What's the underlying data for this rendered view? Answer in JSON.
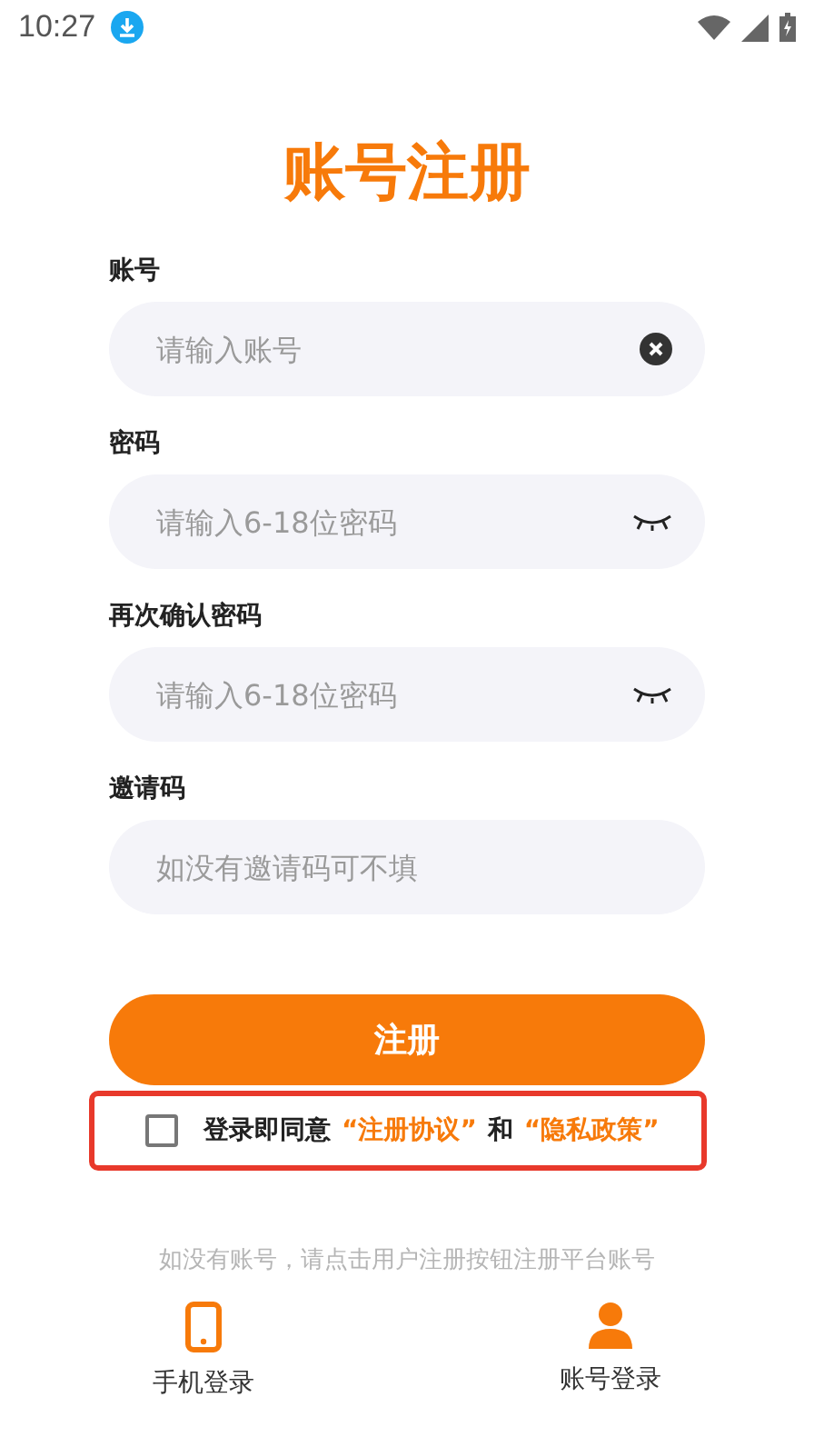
{
  "status_bar": {
    "time": "10:27"
  },
  "title": "账号注册",
  "fields": [
    {
      "label": "账号",
      "placeholder": "请输入账号",
      "kind": "clear"
    },
    {
      "label": "密码",
      "placeholder": "请输入6-18位密码",
      "kind": "eye"
    },
    {
      "label": "再次确认密码",
      "placeholder": "请输入6-18位密码",
      "kind": "eye"
    },
    {
      "label": "邀请码",
      "placeholder": "如没有邀请码可不填",
      "kind": "plain"
    }
  ],
  "submit_button": "注册",
  "agreement": {
    "checked": false,
    "highlighted": true,
    "parts": [
      {
        "kind": "text",
        "text": "登录即同意"
      },
      {
        "kind": "link",
        "text": "“注册协议”"
      },
      {
        "kind": "text",
        "text": "和"
      },
      {
        "kind": "link",
        "text": "“隐私政策”"
      }
    ]
  },
  "hint": "如没有账号，请点击用户注册按钮注册平台账号",
  "login_options": [
    {
      "label": "手机登录",
      "kind": "phone"
    },
    {
      "label": "账号登录",
      "kind": "account"
    }
  ]
}
